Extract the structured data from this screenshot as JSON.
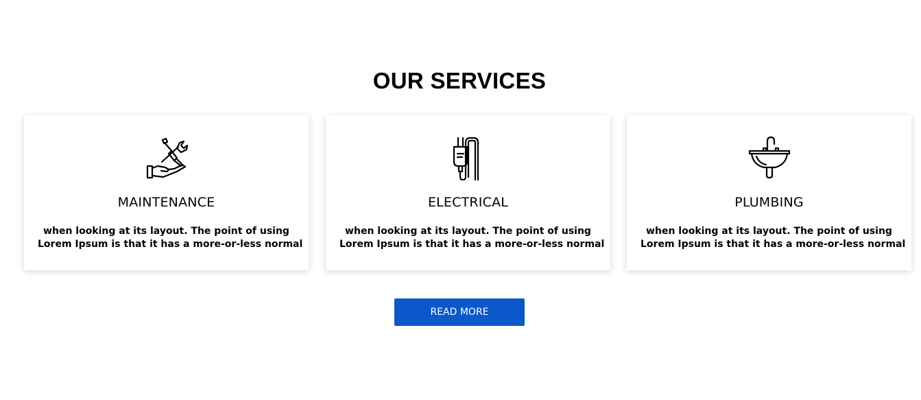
{
  "section": {
    "title": "OUR SERVICES"
  },
  "services": [
    {
      "title": "MAINTENANCE",
      "icon": "tools-hand-icon",
      "text_line1": "when looking at its layout. The point of using",
      "text_line2": "Lorem Ipsum is that it has a more-or-less normal"
    },
    {
      "title": "ELECTRICAL",
      "icon": "plug-icon",
      "text_line1": "when looking at its layout. The point of using",
      "text_line2": "Lorem Ipsum is that it has a more-or-less normal"
    },
    {
      "title": "PLUMBING",
      "icon": "sink-faucet-icon",
      "text_line1": "when looking at its layout. The point of using",
      "text_line2": "Lorem Ipsum is that it has a more-or-less normal"
    }
  ],
  "cta": {
    "label": "READ MORE",
    "color": "#0a58ca"
  }
}
